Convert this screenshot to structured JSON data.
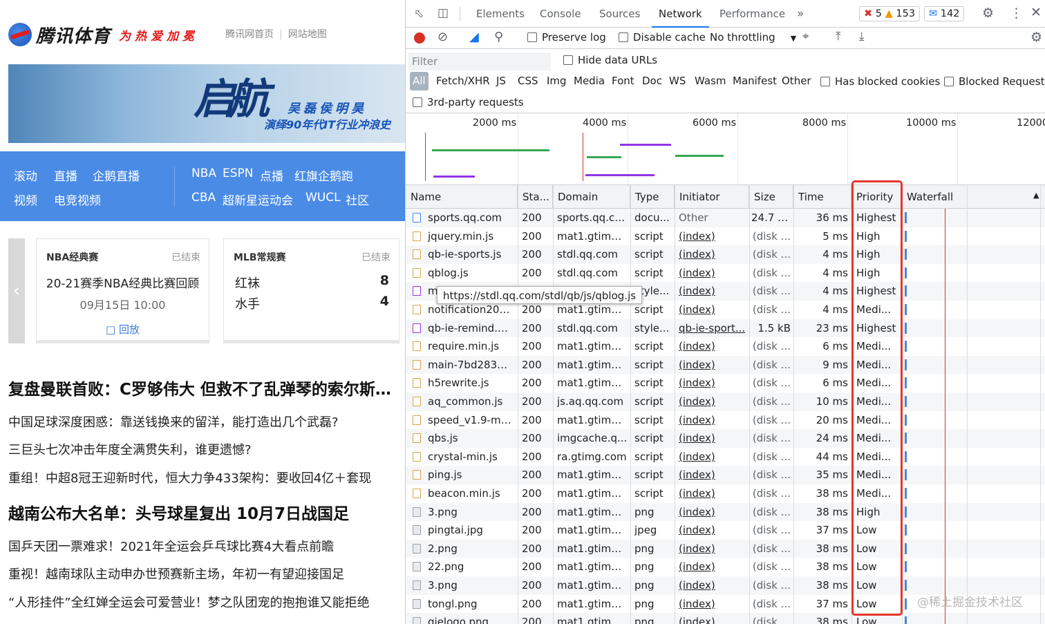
{
  "page": {
    "logo": "腾讯体育",
    "slogan": "为热爱加冕",
    "toplinks": [
      "腾讯网首页",
      "网站地图"
    ],
    "banner": {
      "big": "启航",
      "names": "吴磊侯明昊",
      "sub": "演绎90年代IT行业冲浪史"
    },
    "nav": [
      [
        "滚动",
        "直播",
        "企鹅直播"
      ],
      [
        "视频",
        "电竞视频"
      ],
      [
        "NBA",
        "ESPN",
        "点播",
        "红旗企鹅跑"
      ],
      [
        "CBA",
        "超新星运动会",
        "WUCL",
        "社区"
      ]
    ],
    "card1": {
      "league": "NBA经典赛",
      "status": "已结束",
      "title": "20-21赛季NBA经典比赛回顾",
      "time": "09月15日 10:00",
      "replay": "回放"
    },
    "card2": {
      "league": "MLB常规赛",
      "status": "已结束",
      "team1": "红袜",
      "score1": "8",
      "team2": "水手",
      "score2": "4"
    },
    "headline1": "复盘曼联首败：C罗够伟大 但救不了乱弹琴的索尔斯克亚",
    "news1": [
      "中国足球深度困惑：靠送钱换来的留洋，能打造出几个武磊?",
      "三巨头七次冲击年度全满贯失利，谁更遗憾?",
      "重组！中超8冠王迎新时代，恒大力争433架构：要收回4亿＋套现"
    ],
    "headline2": "越南公布大名单：头号球星复出 10月7日战国足",
    "news2": [
      "国乒天团一票难求！2021年全运会乒乓球比赛4大看点前瞻",
      "重视！越南球队主动申办世预赛新主场，年初一有望迎接国足",
      "“人形挂件”全红婵全运会可爱营业！梦之队团宠的抱抱谁又能拒绝"
    ]
  },
  "devtools": {
    "tabs": [
      "Elements",
      "Console",
      "Sources",
      "Network",
      "Performance"
    ],
    "active_tab": "Network",
    "more_tabs": "»",
    "errors": "5",
    "warnings": "153",
    "messages": "142",
    "toolbar": {
      "preserve_log": "Preserve log",
      "disable_cache": "Disable cache",
      "throttling": "No throttling"
    },
    "filter": {
      "placeholder": "Filter",
      "hide_data_urls": "Hide data URLs"
    },
    "types": [
      "All",
      "Fetch/XHR",
      "JS",
      "CSS",
      "Img",
      "Media",
      "Font",
      "Doc",
      "WS",
      "Wasm",
      "Manifest",
      "Other"
    ],
    "has_blocked_cookies": "Has blocked cookies",
    "blocked_requests": "Blocked Requests",
    "third_party": "3rd-party requests",
    "ticks": [
      "2000 ms",
      "4000 ms",
      "6000 ms",
      "8000 ms",
      "10000 ms",
      "12000"
    ],
    "columns": [
      "Name",
      "Sta...",
      "Domain",
      "Type",
      "Initiator",
      "Size",
      "Time",
      "Priority",
      "Waterfall"
    ],
    "tooltip": "https://stdl.qq.com/stdl/qb/js/qblog.js",
    "watermark": "@稀土掘金技术社区",
    "rows": [
      {
        "icon": "doc",
        "name": "sports.qq.com",
        "status": "200",
        "domain": "sports.qq.com",
        "type": "docu...",
        "initiator": "Other",
        "size": "24.7 kB",
        "time": "36 ms",
        "priority": "Highest"
      },
      {
        "icon": "js",
        "name": "jquery.min.js",
        "status": "200",
        "domain": "mat1.gtimg....",
        "type": "script",
        "initiator": "(index)",
        "size": "(disk ...",
        "time": "5 ms",
        "priority": "High"
      },
      {
        "icon": "js",
        "name": "qb-ie-sports.js",
        "status": "200",
        "domain": "stdl.qq.com",
        "type": "script",
        "initiator": "(index)",
        "size": "(disk ...",
        "time": "4 ms",
        "priority": "High"
      },
      {
        "icon": "js",
        "name": "qblog.js",
        "status": "200",
        "domain": "stdl.qq.com",
        "type": "script",
        "initiator": "(index)",
        "size": "(disk ...",
        "time": "4 ms",
        "priority": "High"
      },
      {
        "icon": "css",
        "name": "m",
        "status": "200",
        "domain": "",
        "type": "style...",
        "initiator": "(index)",
        "size": "(disk ...",
        "time": "4 ms",
        "priority": "Highest"
      },
      {
        "icon": "js",
        "name": "notification2017...",
        "status": "200",
        "domain": "mat1.gtimg....",
        "type": "script",
        "initiator": "(index)",
        "size": "(disk ...",
        "time": "4 ms",
        "priority": "Medi..."
      },
      {
        "icon": "css",
        "name": "qb-ie-remind.cs...",
        "status": "200",
        "domain": "stdl.qq.com",
        "type": "style...",
        "initiator": "qb-ie-sport...",
        "size": "1.5 kB",
        "time": "23 ms",
        "priority": "Highest"
      },
      {
        "icon": "js",
        "name": "require.min.js",
        "status": "200",
        "domain": "mat1.gtimg....",
        "type": "script",
        "initiator": "(index)",
        "size": "(disk ...",
        "time": "6 ms",
        "priority": "Medi..."
      },
      {
        "icon": "js",
        "name": "main-7bd283b6...",
        "status": "200",
        "domain": "mat1.gtimg....",
        "type": "script",
        "initiator": "(index)",
        "size": "(disk ...",
        "time": "9 ms",
        "priority": "Medi..."
      },
      {
        "icon": "js",
        "name": "h5rewrite.js",
        "status": "200",
        "domain": "mat1.gtimg....",
        "type": "script",
        "initiator": "(index)",
        "size": "(disk ...",
        "time": "6 ms",
        "priority": "Medi..."
      },
      {
        "icon": "js",
        "name": "aq_common.js",
        "status": "200",
        "domain": "js.aq.qq.com",
        "type": "script",
        "initiator": "(index)",
        "size": "(disk ...",
        "time": "10 ms",
        "priority": "Medi..."
      },
      {
        "icon": "js",
        "name": "speed_v1.9-min.js",
        "status": "200",
        "domain": "mat1.gtimg....",
        "type": "script",
        "initiator": "(index)",
        "size": "(disk ...",
        "time": "20 ms",
        "priority": "Medi..."
      },
      {
        "icon": "js",
        "name": "qbs.js",
        "status": "200",
        "domain": "imgcache.q...",
        "type": "script",
        "initiator": "(index)",
        "size": "(disk ...",
        "time": "24 ms",
        "priority": "Medi..."
      },
      {
        "icon": "js",
        "name": "crystal-min.js",
        "status": "200",
        "domain": "ra.gtimg.com",
        "type": "script",
        "initiator": "(index)",
        "size": "(disk ...",
        "time": "44 ms",
        "priority": "Medi..."
      },
      {
        "icon": "js",
        "name": "ping.js",
        "status": "200",
        "domain": "mat1.gtimg....",
        "type": "script",
        "initiator": "(index)",
        "size": "(disk ...",
        "time": "35 ms",
        "priority": "Medi..."
      },
      {
        "icon": "js",
        "name": "beacon.min.js",
        "status": "200",
        "domain": "mat1.gtimg....",
        "type": "script",
        "initiator": "(index)",
        "size": "(disk ...",
        "time": "38 ms",
        "priority": "Medi..."
      },
      {
        "icon": "img",
        "name": "3.png",
        "status": "200",
        "domain": "mat1.gtimg....",
        "type": "png",
        "initiator": "(index)",
        "size": "(disk ...",
        "time": "38 ms",
        "priority": "High"
      },
      {
        "icon": "img",
        "name": "pingtai.jpg",
        "status": "200",
        "domain": "mat1.gtimg....",
        "type": "jpeg",
        "initiator": "(index)",
        "size": "(disk ...",
        "time": "37 ms",
        "priority": "Low"
      },
      {
        "icon": "img",
        "name": "2.png",
        "status": "200",
        "domain": "mat1.gtimg....",
        "type": "png",
        "initiator": "(index)",
        "size": "(disk ...",
        "time": "38 ms",
        "priority": "Low"
      },
      {
        "icon": "img",
        "name": "22.png",
        "status": "200",
        "domain": "mat1.gtimg....",
        "type": "png",
        "initiator": "(index)",
        "size": "(disk ...",
        "time": "38 ms",
        "priority": "Low"
      },
      {
        "icon": "img",
        "name": "3.png",
        "status": "200",
        "domain": "mat1.gtimg....",
        "type": "png",
        "initiator": "(index)",
        "size": "(disk ...",
        "time": "38 ms",
        "priority": "Low"
      },
      {
        "icon": "img",
        "name": "tongl.png",
        "status": "200",
        "domain": "mat1.gtimg....",
        "type": "png",
        "initiator": "(index)",
        "size": "(disk ...",
        "time": "37 ms",
        "priority": "Low"
      },
      {
        "icon": "img",
        "name": "qielogo.png",
        "status": "200",
        "domain": "mat1.gtimg....",
        "type": "png",
        "initiator": "(index)",
        "size": "(disk ...",
        "time": "38 ms",
        "priority": "Low"
      }
    ]
  }
}
